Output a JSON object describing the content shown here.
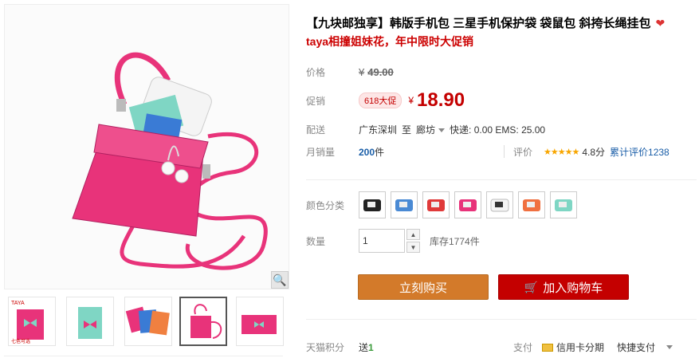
{
  "title": "【九块邮独享】韩版手机包 三星手机保护袋 袋鼠包 斜挎长绳挂包",
  "title_icon": "heart-bow-icon",
  "subtitle": "taya相撞姐妹花，年中限时大促销",
  "price": {
    "label": "价格",
    "currency": "¥",
    "value": "49.00"
  },
  "promo": {
    "label": "促销",
    "badge": "618大促",
    "currency": "¥",
    "value": "18.90"
  },
  "shipping": {
    "label": "配送",
    "from": "广东深圳",
    "to_word": "至",
    "to": "廊坊",
    "fees": "快递: 0.00 EMS: 25.00"
  },
  "sales": {
    "label": "月销量",
    "count": "200",
    "unit": "件"
  },
  "rating": {
    "label": "评价",
    "stars": "★★★★★",
    "score": "4.8分",
    "cumulative": "累计评价1238"
  },
  "color": {
    "label": "颜色分类",
    "swatches": 7
  },
  "quantity": {
    "label": "数量",
    "value": "1",
    "stock": "库存1774件"
  },
  "buttons": {
    "buy": "立刻购买",
    "cart": "加入购物车"
  },
  "points": {
    "label": "天猫积分",
    "prefix": "送",
    "value": "1"
  },
  "payment": {
    "label": "支付",
    "credit": "信用卡分期",
    "fast": "快捷支付"
  },
  "thumbnails": 5,
  "thumbnail_text": {
    "brand": "TAYA",
    "corner": "七色可选"
  },
  "colors": {
    "pink": "#e8337a",
    "mint": "#7fd6c4",
    "red": "#c40000",
    "orange": "#d37a2a",
    "link": "#1a5ea8"
  }
}
